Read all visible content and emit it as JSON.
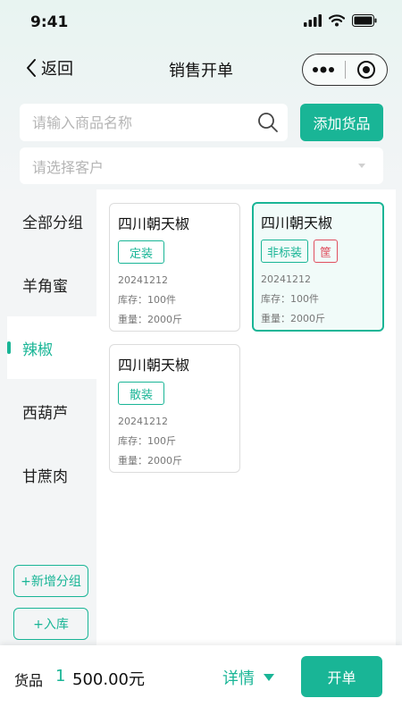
{
  "status_bar": {
    "time": "9:41"
  },
  "nav": {
    "back_label": "返回",
    "title": "销售开单"
  },
  "search": {
    "placeholder": "请输入商品名称",
    "add_button": "添加货品"
  },
  "customer": {
    "placeholder": "请选择客户"
  },
  "sidebar": {
    "items": [
      {
        "label": "全部分组",
        "active": false
      },
      {
        "label": "羊角蜜",
        "active": false
      },
      {
        "label": "辣椒",
        "active": true
      },
      {
        "label": "西葫芦",
        "active": false
      },
      {
        "label": "甘蔗肉",
        "active": false
      }
    ],
    "add_group": "+新增分组",
    "stock_in": "+入库"
  },
  "products": [
    {
      "name": "四川朝天椒",
      "tags": [
        "定装"
      ],
      "date": "20241212",
      "stock": "库存：100件",
      "weight": "重量：2000斤",
      "selected": false
    },
    {
      "name": "四川朝天椒",
      "tags": [
        "非标装",
        "筐"
      ],
      "date": "20241212",
      "stock": "库存：100件",
      "weight": "重量：2000斤",
      "selected": true
    },
    {
      "name": "四川朝天椒",
      "tags": [
        "散装"
      ],
      "date": "20241212",
      "stock": "库存：100斤",
      "weight": "重量：2000斤",
      "selected": false
    }
  ],
  "bottom": {
    "goods_label": "货品",
    "goods_count": "1",
    "amount": "500.00元",
    "detail_label": "详情",
    "order_button": "开单"
  },
  "colors": {
    "accent": "#19b596",
    "danger": "#e04f5f"
  }
}
